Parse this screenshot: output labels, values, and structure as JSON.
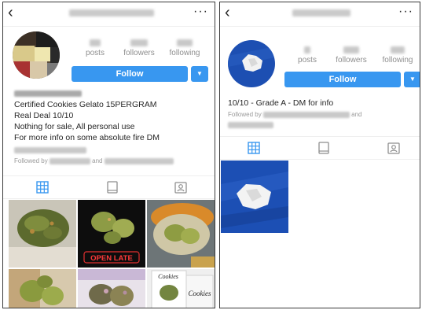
{
  "left_profile": {
    "top_bar": {
      "back_icon": "chevron-left-icon",
      "more_icon": "ellipsis-icon",
      "more_label": "···"
    },
    "stats": [
      {
        "label": "posts"
      },
      {
        "label": "followers"
      },
      {
        "label": "following"
      }
    ],
    "follow_label": "Follow",
    "dropdown_glyph": "▼",
    "bio": [
      "Certified Cookies Gelato 15PERGRAM",
      "Real Deal 10/10",
      "Nothing for sale, All personal use",
      "For more info on some absolute fire DM"
    ],
    "followed_by_prefix": "Followed by",
    "followed_by_and": "and",
    "tabs": [
      "grid-icon",
      "feed-icon",
      "tagged-icon"
    ],
    "grid_caption_sign": "OPEN LATE",
    "grid_caption_bag": "Cookies"
  },
  "right_profile": {
    "top_bar": {
      "back_icon": "chevron-left-icon",
      "more_icon": "ellipsis-icon",
      "more_label": "···"
    },
    "stats": [
      {
        "label": "posts"
      },
      {
        "label": "followers"
      },
      {
        "label": "following"
      }
    ],
    "follow_label": "Follow",
    "dropdown_glyph": "▼",
    "bio": [
      "10/10 - Grade A - DM for info"
    ],
    "followed_by_prefix": "Followed by",
    "followed_by_and": "and",
    "tabs": [
      "grid-icon",
      "feed-icon",
      "tagged-icon"
    ]
  },
  "colors": {
    "accent": "#3897f0",
    "muted": "#8e8e8e",
    "text": "#262626"
  }
}
